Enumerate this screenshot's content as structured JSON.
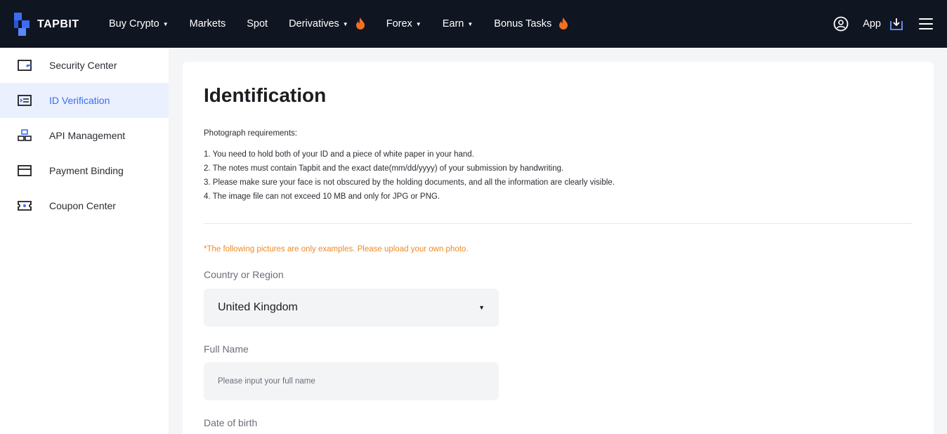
{
  "brand": {
    "name": "TAPBIT",
    "accent": "#3a6cf6"
  },
  "nav": {
    "items": [
      {
        "label": "Buy Crypto",
        "dropdown": true,
        "hot": false
      },
      {
        "label": "Markets",
        "dropdown": false,
        "hot": false
      },
      {
        "label": "Spot",
        "dropdown": false,
        "hot": false
      },
      {
        "label": "Derivatives",
        "dropdown": true,
        "hot": true
      },
      {
        "label": "Forex",
        "dropdown": true,
        "hot": false
      },
      {
        "label": "Earn",
        "dropdown": true,
        "hot": false
      },
      {
        "label": "Bonus Tasks",
        "dropdown": false,
        "hot": true
      }
    ],
    "caret": "▼",
    "app_label": "App"
  },
  "sidebar": {
    "items": [
      {
        "label": "Security Center",
        "icon": "wallet-icon",
        "active": false
      },
      {
        "label": "ID Verification",
        "icon": "id-card-icon",
        "active": true
      },
      {
        "label": "API Management",
        "icon": "api-icon",
        "active": false
      },
      {
        "label": "Payment Binding",
        "icon": "card-icon",
        "active": false
      },
      {
        "label": "Coupon Center",
        "icon": "coupon-icon",
        "active": false
      }
    ]
  },
  "main": {
    "title": "Identification",
    "requirements_heading": "Photograph requirements:",
    "requirements": [
      "1. You need to hold both of your ID and a piece of white paper in your hand.",
      "2. The notes must contain Tapbit and the exact date(mm/dd/yyyy) of your submission by handwriting.",
      "3. Please make sure your face is not obscured by the holding documents, and all the information are clearly visible.",
      "4. The image file can not exceed 10 MB and only for JPG or PNG."
    ],
    "note": "*The following pictures are only examples. Please upload your own photo.",
    "country_label": "Country or Region",
    "country_value": "United Kingdom",
    "select_caret": "▼",
    "fullname_label": "Full Name",
    "fullname_placeholder": "Please input your full name",
    "dob_label": "Date of birth"
  }
}
